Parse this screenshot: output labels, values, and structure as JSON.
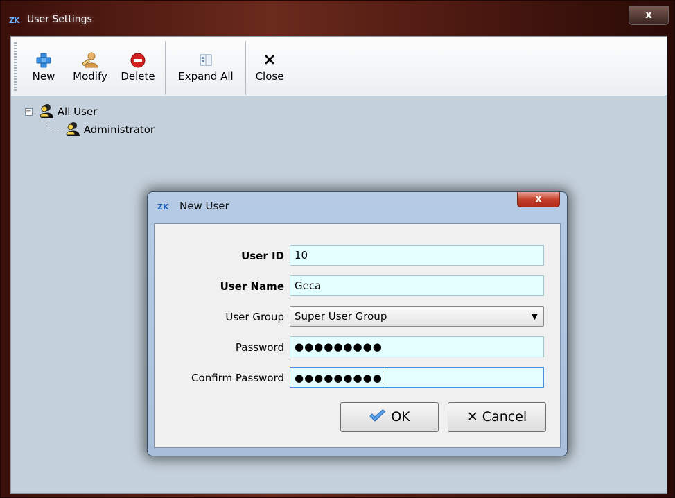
{
  "window": {
    "logo": "ZK",
    "title": "User Settings",
    "close_label": "x"
  },
  "toolbar": {
    "new_label": "New",
    "modify_label": "Modify",
    "delete_label": "Delete",
    "expand_all_label": "Expand All",
    "close_label": "Close"
  },
  "tree": {
    "root_label": "All User",
    "root_toggle": "−",
    "children": [
      {
        "label": "Administrator"
      }
    ]
  },
  "dialog": {
    "logo": "ZK",
    "title": "New User",
    "close_label": "x",
    "fields": {
      "user_id": {
        "label": "User ID",
        "value": "10"
      },
      "user_name": {
        "label": "User Name",
        "value": "Geca"
      },
      "user_group": {
        "label": "User Group",
        "value": "Super User Group"
      },
      "password": {
        "label": "Password",
        "value": "●●●●●●●●●"
      },
      "confirm_password": {
        "label": "Confirm Password",
        "value": "●●●●●●●●●"
      }
    },
    "ok_label": "OK",
    "cancel_label": "Cancel"
  },
  "colors": {
    "field_bg": "#e3ffff",
    "client_bg": "#c4d0db",
    "delete_red": "#d42020",
    "add_blue": "#3c8fe0"
  },
  "icons": {
    "new": "plus-icon",
    "modify": "user-edit-icon",
    "delete": "no-entry-icon",
    "expand_all": "expand-icon",
    "close": "x-icon",
    "tree_user": "user-group-icon",
    "ok": "checkmark-icon",
    "cancel": "x-icon"
  }
}
